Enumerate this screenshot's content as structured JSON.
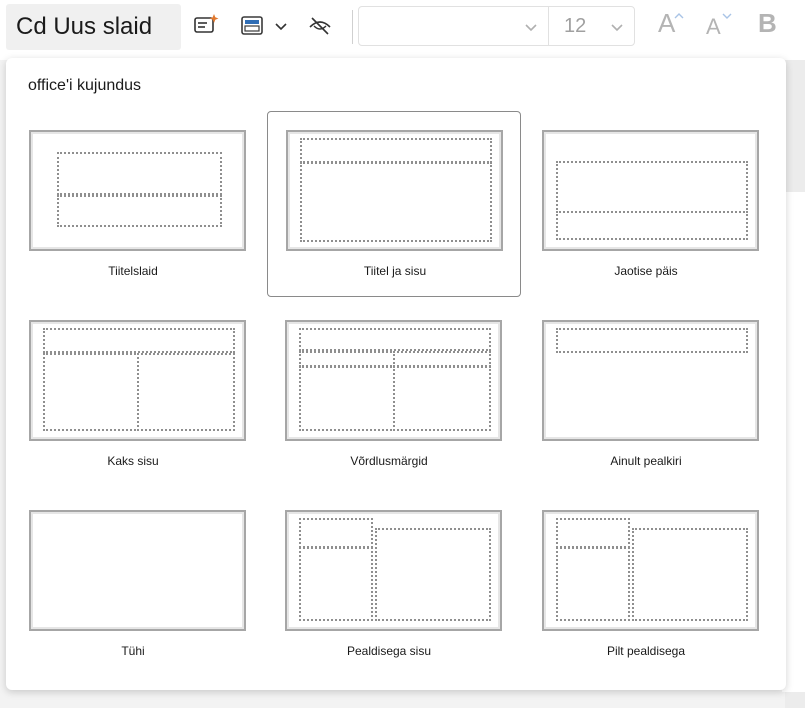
{
  "toolbar": {
    "new_slide_label": "Cd Uus slaid",
    "font_size_value": "12",
    "grow_font_letter": "A",
    "shrink_font_letter": "A",
    "bold_letter": "B",
    "icons": [
      "designer-icon",
      "layout-icon",
      "chevron-down-icon",
      "hide-slide-icon"
    ]
  },
  "layout_menu": {
    "section_title": "office'i kujundus",
    "selected": "Tiitel ja sisu",
    "layouts": [
      {
        "label": "Tiitelslaid"
      },
      {
        "label": "Tiitel ja sisu"
      },
      {
        "label": "Jaotise päis"
      },
      {
        "label": "Kaks sisu"
      },
      {
        "label": "Võrdlusmärgid"
      },
      {
        "label": "Ainult pealkiri"
      },
      {
        "label": "Tühi"
      },
      {
        "label": "Pealdisega sisu"
      },
      {
        "label": "Pilt pealdisega"
      }
    ]
  },
  "colors": {
    "panel_bg": "#ffffff",
    "selected_border": "#8a8a8a",
    "placeholder_dots": "#8f8f8f",
    "disabled_text": "#b4b4b4"
  }
}
